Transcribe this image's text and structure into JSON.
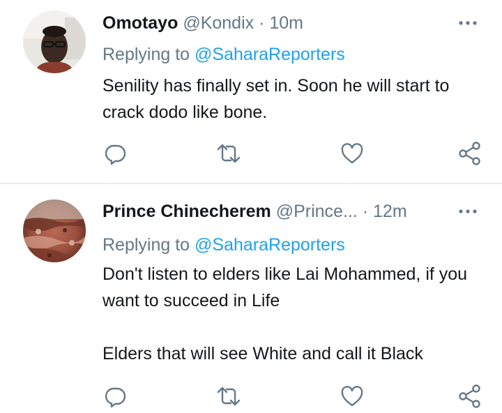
{
  "colors": {
    "text": "#14171a",
    "secondary": "#657786",
    "link": "#1da1f2",
    "divider": "#e6ecf0"
  },
  "tweets": [
    {
      "name": "Omotayo",
      "handle": "@Kondix",
      "separator": "·",
      "time": "10m",
      "replying_prefix": "Replying to",
      "replying_to": "@SaharaReporters",
      "paragraphs": [
        "Senility has finally set in. Soon he will start to crack dodo like bone."
      ],
      "avatar_icon": "person-photo-avatar",
      "more_icon": "more-dots-icon",
      "actions": [
        "reply-icon",
        "retweet-icon",
        "like-icon",
        "share-icon"
      ]
    },
    {
      "name": "Prince Chinecherem",
      "handle": "@Prince...",
      "separator": "·",
      "time": "12m",
      "replying_prefix": "Replying to",
      "replying_to": "@SaharaReporters",
      "paragraphs": [
        "Don't listen to elders like Lai Mohammed, if you want to succeed in Life",
        "Elders that will see White and call it Black"
      ],
      "avatar_icon": "abstract-photo-avatar",
      "more_icon": "more-dots-icon",
      "actions": [
        "reply-icon",
        "retweet-icon",
        "like-icon",
        "share-icon"
      ]
    }
  ]
}
